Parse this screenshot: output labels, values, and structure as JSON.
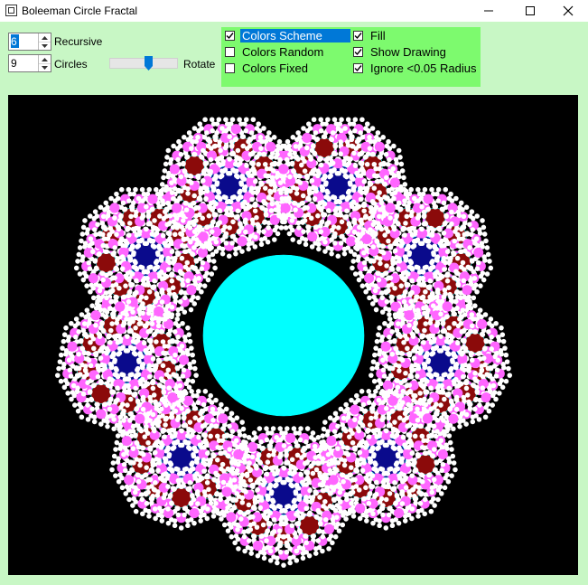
{
  "window": {
    "title": "Boleeman Circle Fractal",
    "controls": [
      "minimize-icon",
      "maximize-icon",
      "close-icon"
    ]
  },
  "controls": {
    "recursive": {
      "value": "6",
      "label": "Recursive"
    },
    "circles": {
      "value": "9",
      "label": "Circles"
    },
    "rotate": {
      "label": "Rotate",
      "level": 0.58
    }
  },
  "options": [
    {
      "label": "Colors Scheme",
      "checked": true,
      "highlighted": true
    },
    {
      "label": "Colors Random",
      "checked": false
    },
    {
      "label": "Colors Fixed",
      "checked": false
    },
    {
      "label": "Fill",
      "checked": true
    },
    {
      "label": "Show Drawing",
      "checked": true
    },
    {
      "label": "Ignore <0.05 Radius",
      "checked": true
    }
  ],
  "colors": {
    "background": "#c8f7c5",
    "panel": "#7dfa6e",
    "canvas": "#000000",
    "center_circle": "#00ffff",
    "level1": "#0a0a8c",
    "level2": "#8b0a0a",
    "level3": "#ff66ff",
    "level4": "#ffffff",
    "accent": "#0078d7"
  },
  "fractal": {
    "circles": 9,
    "depth_shown": 4
  }
}
